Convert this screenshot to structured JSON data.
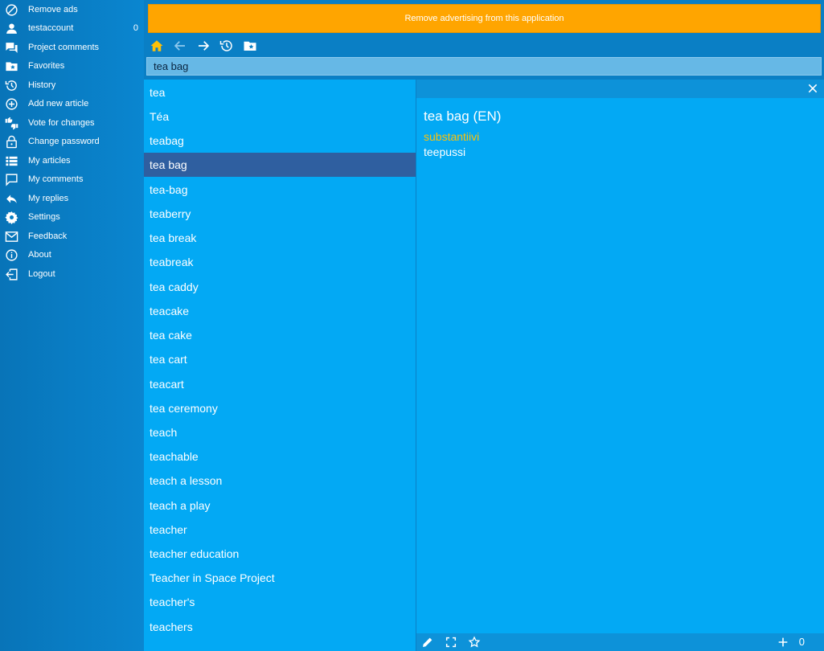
{
  "sidebar": {
    "items": [
      {
        "label": "Remove ads",
        "icon": "block-icon"
      },
      {
        "label": "testaccount",
        "icon": "user-icon",
        "count": "0"
      },
      {
        "label": "Project comments",
        "icon": "chat-bubbles-icon"
      },
      {
        "label": "Favorites",
        "icon": "folder-star-icon"
      },
      {
        "label": "History",
        "icon": "history-icon"
      },
      {
        "label": "Add new article",
        "icon": "add-circle-icon"
      },
      {
        "label": "Vote for changes",
        "icon": "thumbs-icon"
      },
      {
        "label": "Change password",
        "icon": "lock-icon"
      },
      {
        "label": "My articles",
        "icon": "list-icon"
      },
      {
        "label": "My comments",
        "icon": "comment-icon"
      },
      {
        "label": "My replies",
        "icon": "reply-icon"
      },
      {
        "label": "Settings",
        "icon": "gear-icon"
      },
      {
        "label": "Feedback",
        "icon": "mail-icon"
      },
      {
        "label": "About",
        "icon": "info-icon"
      },
      {
        "label": "Logout",
        "icon": "logout-icon"
      }
    ]
  },
  "ad_banner": {
    "text": "Remove advertising from this application",
    "color": "#ffa500"
  },
  "toolbar": {
    "icons": [
      "home-icon",
      "back-arrow-icon",
      "forward-arrow-icon",
      "history-icon",
      "folder-star-icon"
    ]
  },
  "search": {
    "value": "tea bag"
  },
  "word_list": {
    "selected": "tea bag",
    "items": [
      "tea",
      "Téa",
      "teabag",
      "tea bag",
      "tea-bag",
      "teaberry",
      "tea break",
      "teabreak",
      "tea caddy",
      "teacake",
      "tea cake",
      "tea cart",
      "teacart",
      "tea ceremony",
      "teach",
      "teachable",
      "teach a lesson",
      "teach a play",
      "teacher",
      "teacher education",
      "Teacher in Space Project",
      "teacher's",
      "teachers"
    ]
  },
  "entry": {
    "title": "tea bag (EN)",
    "part_of_speech": "substantiivi",
    "translation": "teepussi"
  },
  "footer": {
    "icons": [
      "edit-icon",
      "fullscreen-icon",
      "star-icon",
      "plus-icon"
    ],
    "vote_count": "0"
  },
  "colors": {
    "accent": "#ffc107",
    "list_bg": "#03a9f4",
    "selected_bg": "#2f5fa0",
    "sidebar_bg": "#0874b8"
  }
}
